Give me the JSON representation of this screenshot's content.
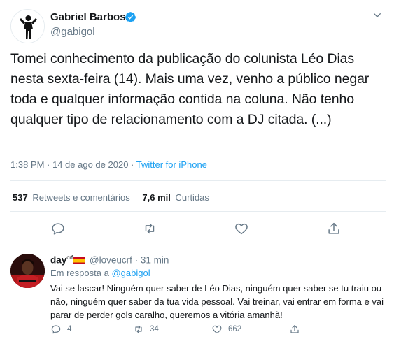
{
  "tweet": {
    "author_name": "Gabriel Barbosa",
    "author_handle": "@gabigol",
    "text": "Tomei conhecimento da publicação do colunista Léo Dias nesta sexta-feira (14). Mais uma vez, venho a público negar toda e qualquer informação contida na coluna. Não tenho qualquer tipo de relacionamento com a DJ citada. (...)",
    "time": "1:38 PM",
    "date_sep": " · ",
    "date": "14 de ago de 2020",
    "source_sep": " · ",
    "source": "Twitter for iPhone",
    "retweets_count": "537",
    "retweets_label": "Retweets e comentários",
    "likes_count": "7,6 mil",
    "likes_label": "Curtidas"
  },
  "reply": {
    "name": "day",
    "name_sup": "crf",
    "handle": "@loveucrf",
    "time_sep": " · ",
    "time": "31 min",
    "in_reply_label": "Em resposta a",
    "in_reply_mention": "@gabigol",
    "text": "Vai se lascar! Ninguém quer saber de Léo Dias, ninguém quer saber se tu traiu ou não, ninguém quer saber da tua vida pessoal. Vai treinar, vai entrar em forma e vai parar de perder gols caralho, queremos a vitória amanhã!",
    "reply_count": "4",
    "retweet_count": "34",
    "like_count": "662"
  },
  "colors": {
    "accent": "#1da1f2",
    "secondary_text": "#657786",
    "primary_text": "#14171a",
    "divider": "#e6ecf0"
  },
  "icons": {
    "main_actions": [
      "reply-icon",
      "retweet-icon",
      "like-icon",
      "share-icon"
    ],
    "reply_actions": [
      "reply-icon",
      "retweet-icon",
      "like-icon",
      "share-icon"
    ]
  }
}
